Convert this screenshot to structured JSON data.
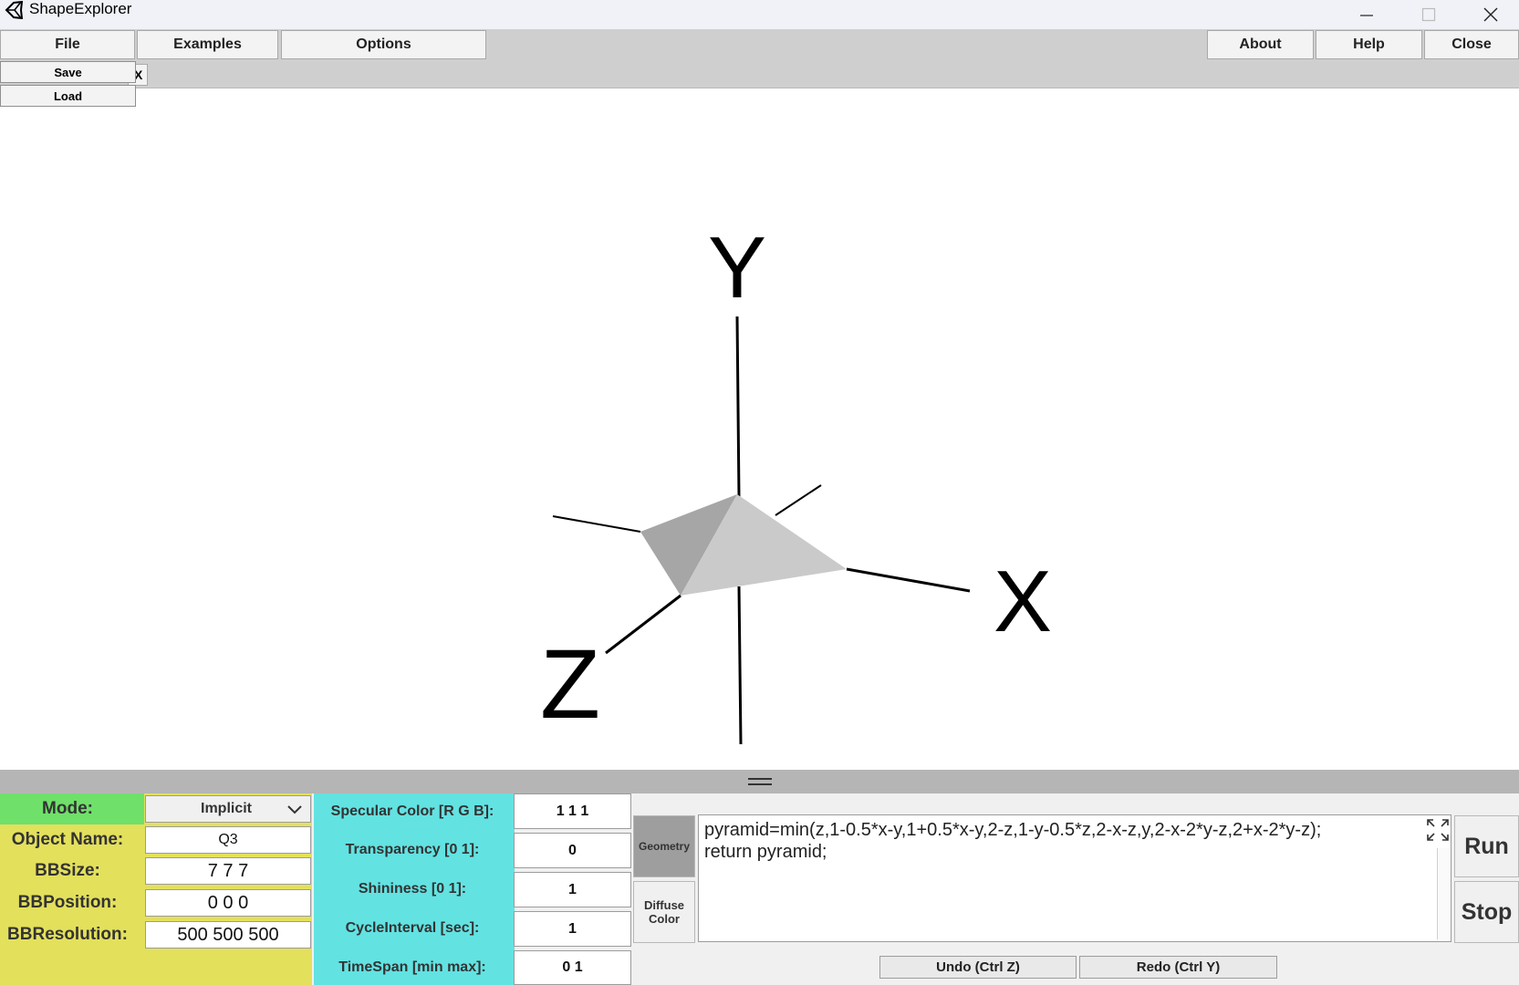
{
  "window": {
    "title": "ShapeExplorer",
    "icon": "unity-logo-icon",
    "controls": [
      "minimize-icon",
      "maximize-icon",
      "close-icon"
    ]
  },
  "menu": {
    "file": "File",
    "examples": "Examples",
    "options": "Options",
    "about": "About",
    "help": "Help",
    "close": "Close",
    "strip_tab": "X"
  },
  "file_dropdown": {
    "save": "Save",
    "load": "Load"
  },
  "viewport": {
    "axes": {
      "x": "X",
      "y": "Y",
      "z": "Z"
    },
    "shape_colors": {
      "left_face": "#a6a6a6",
      "right_face": "#cacaca"
    }
  },
  "params_left": {
    "mode_label": "Mode:",
    "mode_value": "Implicit",
    "object_name_label": "Object Name:",
    "object_name_value": "Q3",
    "bbsize_label": "BBSize:",
    "bbsize_value": "7 7 7",
    "bbposition_label": "BBPosition:",
    "bbposition_value": "0 0 0",
    "bbresolution_label": "BBResolution:",
    "bbresolution_value": "500 500 500"
  },
  "params_mid": {
    "specular_label": "Specular Color [R G B]:",
    "specular_value": "1 1 1",
    "transparency_label": "Transparency [0 1]:",
    "transparency_value": "0",
    "shininess_label": "Shininess [0 1]:",
    "shininess_value": "1",
    "cycle_label": "CycleInterval [sec]:",
    "cycle_value": "1",
    "timespan_label": "TimeSpan [min max]:",
    "timespan_value": "0 1"
  },
  "editor": {
    "geometry_tab": "Geometry",
    "diffuse_tab": "Diffuse Color",
    "code": "pyramid=min(z,1-0.5*x-y,1+0.5*x-y,2-z,1-y-0.5*z,2-x-z,y,2-x-2*y-z,2+x-2*y-z);\nreturn pyramid;",
    "run": "Run",
    "stop": "Stop",
    "undo": "Undo (Ctrl Z)",
    "redo": "Redo (Ctrl Y)"
  },
  "colors": {
    "mode_green": "#6fe06a",
    "param_yellow": "#e3e05c",
    "param_cyan": "#63e2e2"
  }
}
